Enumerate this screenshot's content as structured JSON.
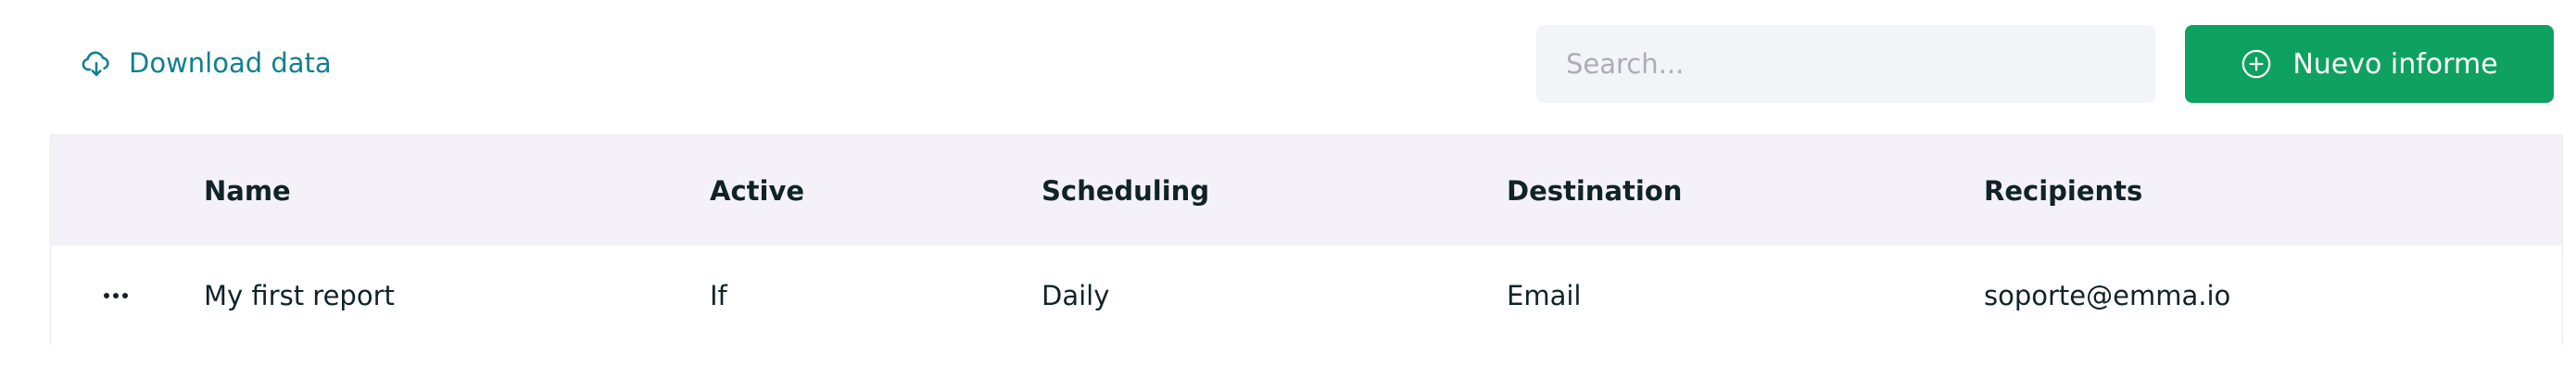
{
  "toolbar": {
    "download_label": "Download data",
    "download_icon": "cloud-download-icon",
    "search_placeholder": "Search...",
    "new_report_label": "Nuevo informe",
    "new_report_icon": "plus-circle-icon",
    "accent_color": "#0ea160",
    "link_color": "#11808d"
  },
  "table": {
    "columns": [
      "Name",
      "Active",
      "Scheduling",
      "Destination",
      "Recipients"
    ],
    "rows": [
      {
        "name": "My first report",
        "active": "If",
        "scheduling": "Daily",
        "destination": "Email",
        "recipients": "soporte@emma.io"
      }
    ]
  }
}
